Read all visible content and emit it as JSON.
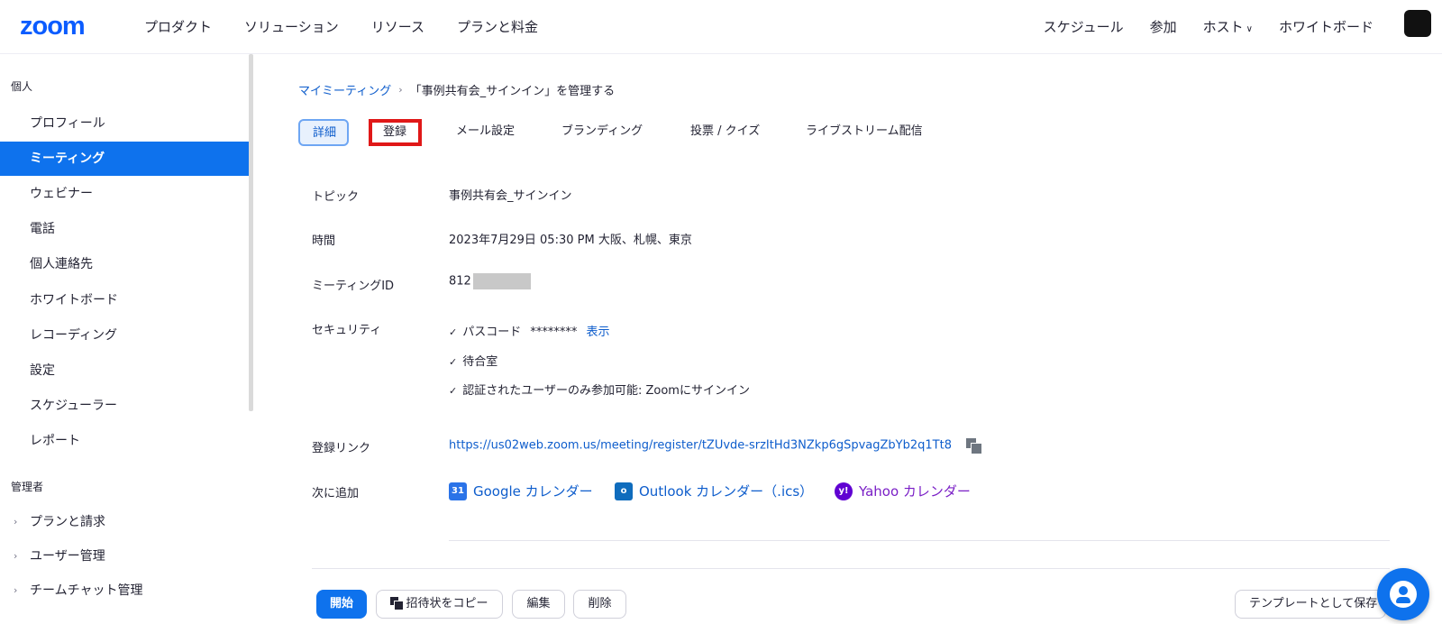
{
  "topnav": {
    "logo": "zoom",
    "left_items": [
      "プロダクト",
      "ソリューション",
      "リソース",
      "プランと料金"
    ],
    "right_items": [
      {
        "label": "スケジュール",
        "dropdown": false
      },
      {
        "label": "参加",
        "dropdown": false
      },
      {
        "label": "ホスト",
        "dropdown": true
      },
      {
        "label": "ホワイトボード",
        "dropdown": false
      }
    ]
  },
  "sidebar": {
    "personal_label": "個人",
    "personal_items": [
      {
        "label": "プロフィール",
        "active": false
      },
      {
        "label": "ミーティング",
        "active": true
      },
      {
        "label": "ウェビナー",
        "active": false
      },
      {
        "label": "電話",
        "active": false
      },
      {
        "label": "個人連絡先",
        "active": false
      },
      {
        "label": "ホワイトボード",
        "active": false
      },
      {
        "label": "レコーディング",
        "active": false
      },
      {
        "label": "設定",
        "active": false
      },
      {
        "label": "スケジューラー",
        "active": false
      },
      {
        "label": "レポート",
        "active": false
      }
    ],
    "admin_label": "管理者",
    "admin_items": [
      {
        "label": "プランと請求"
      },
      {
        "label": "ユーザー管理"
      },
      {
        "label": "チームチャット管理"
      }
    ]
  },
  "breadcrumb": {
    "parent": "マイミーティング",
    "current": "「事例共有会_サインイン」を管理する"
  },
  "tabs": [
    {
      "label": "詳細",
      "state": "selected"
    },
    {
      "label": "登録",
      "state": "highlight"
    },
    {
      "label": "メール設定",
      "state": "normal"
    },
    {
      "label": "ブランディング",
      "state": "normal"
    },
    {
      "label": "投票 / クイズ",
      "state": "normal"
    },
    {
      "label": "ライブストリーム配信",
      "state": "normal"
    }
  ],
  "details": {
    "topic_label": "トピック",
    "topic_value": "事例共有会_サインイン",
    "time_label": "時間",
    "time_value": "2023年7月29日 05:30 PM 大阪、札幌、東京",
    "meeting_id_label": "ミーティングID",
    "meeting_id_prefix": "812",
    "security_label": "セキュリティ",
    "security_items": {
      "passcode_label": "パスコード",
      "passcode_mask": "********",
      "passcode_show": "表示",
      "waiting_room": "待合室",
      "auth_only": "認証されたユーザーのみ参加可能: Zoomにサインイン"
    },
    "reg_link_label": "登録リンク",
    "reg_link_value": "https://us02web.zoom.us/meeting/register/tZUvde-srzItHd3NZkp6gSpvagZbYb2q1Tt8",
    "add_to_label": "次に追加",
    "calendars": {
      "google": "Google カレンダー",
      "outlook": "Outlook カレンダー（.ics）",
      "yahoo": "Yahoo カレンダー"
    }
  },
  "actions": {
    "start": "開始",
    "copy_invite": "招待状をコピー",
    "edit": "編集",
    "delete": "削除",
    "save_template": "テンプレートとして保存"
  },
  "colors": {
    "brand": "#0b5cff",
    "active_nav": "#0e72ed",
    "link": "#0e5dcc",
    "highlight_border": "#e01818"
  }
}
